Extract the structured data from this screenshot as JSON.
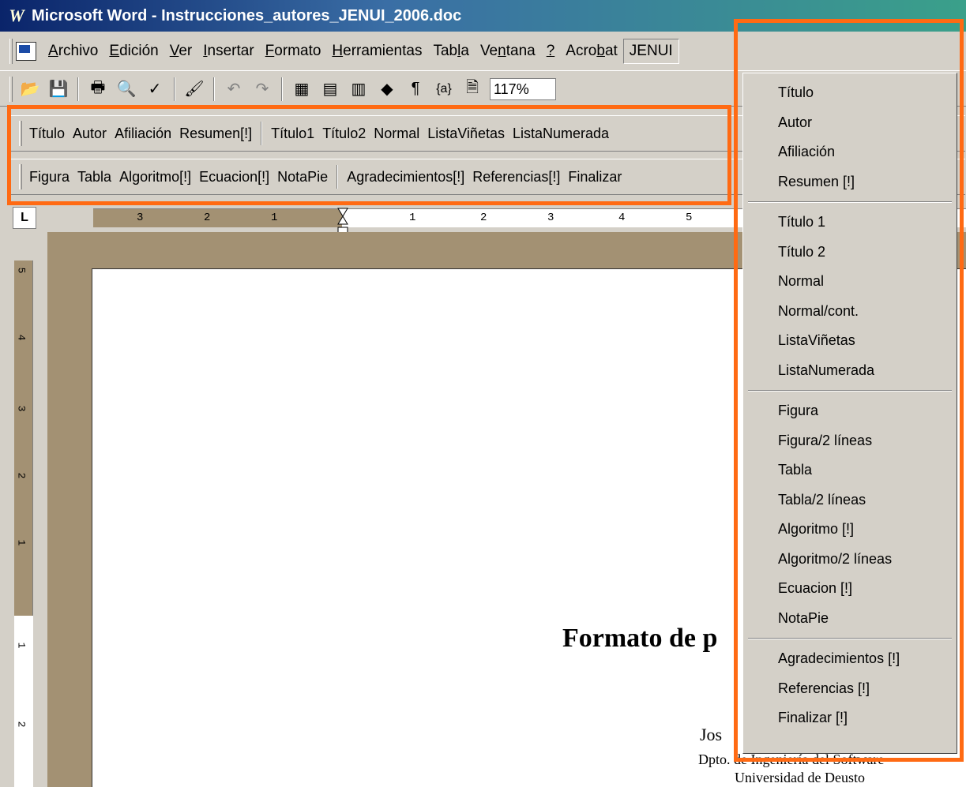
{
  "window": {
    "title": "Microsoft Word - Instrucciones_autores_JENUI_2006.doc",
    "app_icon": "word-icon"
  },
  "menubar": {
    "items": [
      {
        "pre": "",
        "u": "A",
        "post": "rchivo"
      },
      {
        "pre": "",
        "u": "E",
        "post": "dición"
      },
      {
        "pre": "",
        "u": "V",
        "post": "er"
      },
      {
        "pre": "",
        "u": "I",
        "post": "nsertar"
      },
      {
        "pre": "",
        "u": "F",
        "post": "ormato"
      },
      {
        "pre": "",
        "u": "H",
        "post": "erramientas"
      },
      {
        "pre": "Tab",
        "u": "l",
        "post": "a"
      },
      {
        "pre": "Ve",
        "u": "n",
        "post": "tana"
      },
      {
        "pre": "",
        "u": "?",
        "post": ""
      },
      {
        "pre": "Acro",
        "u": "b",
        "post": "at"
      }
    ],
    "active": "JENUI"
  },
  "toolbar": {
    "zoom": "117%"
  },
  "stylebar1": {
    "group1": [
      "Título",
      "Autor",
      "Afiliación",
      "Resumen[!]"
    ],
    "group2": [
      "Título1",
      "Título2",
      "Normal",
      "ListaViñetas",
      "ListaNumerada"
    ]
  },
  "stylebar2": {
    "group1": [
      "Figura",
      "Tabla",
      "Algoritmo[!]",
      "Ecuacion[!]",
      "NotaPie"
    ],
    "group2": [
      "Agradecimientos[!]",
      "Referencias[!]",
      "Finalizar"
    ]
  },
  "ruler": {
    "corner": "L",
    "ticks": [
      "3",
      "2",
      "1",
      "1",
      "2",
      "3",
      "4",
      "5"
    ],
    "vticks": [
      "5",
      "4",
      "3",
      "2",
      "1",
      "1",
      "2"
    ]
  },
  "document": {
    "title": "Formato de p",
    "author": "Jos",
    "dept": "Dpto. de Ingeniería del Software",
    "univ": "Universidad de Deusto"
  },
  "jenui_menu": {
    "group1": [
      "Título",
      "Autor",
      "Afiliación",
      "Resumen [!]"
    ],
    "group2": [
      "Título 1",
      "Título 2",
      "Normal",
      "Normal/cont.",
      "ListaViñetas",
      "ListaNumerada"
    ],
    "group3": [
      "Figura",
      "Figura/2 líneas",
      "Tabla",
      "Tabla/2 líneas",
      "Algoritmo [!]",
      "Algoritmo/2 líneas",
      "Ecuacion [!]",
      "NotaPie"
    ],
    "group4": [
      "Agradecimientos [!]",
      "Referencias [!]",
      "Finalizar [!]"
    ]
  },
  "colors": {
    "highlight": "#ff6a13",
    "chrome": "#d4d0c8",
    "margin": "#a39173"
  }
}
